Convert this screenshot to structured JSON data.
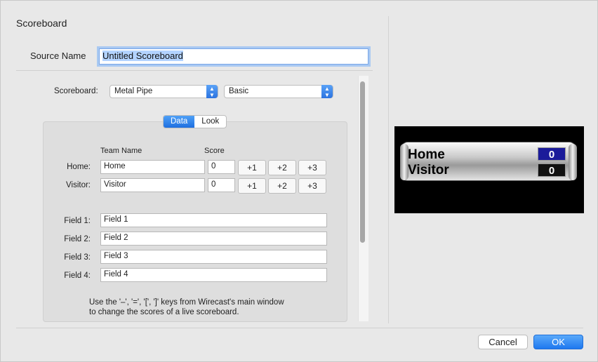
{
  "dialog": {
    "title": "Scoreboard"
  },
  "source": {
    "label": "Source Name",
    "value": "Untitled Scoreboard"
  },
  "scoreboard": {
    "label": "Scoreboard:",
    "style_value": "Metal Pipe",
    "mode_value": "Basic"
  },
  "tabs": [
    {
      "label": "Data",
      "active": true
    },
    {
      "label": "Look",
      "active": false
    }
  ],
  "columns": {
    "team_name": "Team Name",
    "score": "Score"
  },
  "teams": [
    {
      "label": "Home:",
      "name": "Home",
      "score": "0"
    },
    {
      "label": "Visitor:",
      "name": "Visitor",
      "score": "0"
    }
  ],
  "increments": [
    "+1",
    "+2",
    "+3"
  ],
  "fields": [
    {
      "label": "Field 1:",
      "value": "Field 1"
    },
    {
      "label": "Field 2:",
      "value": "Field 2"
    },
    {
      "label": "Field 3:",
      "value": "Field 3"
    },
    {
      "label": "Field 4:",
      "value": "Field 4"
    }
  ],
  "help": {
    "line1": "Use the '–', '=', '[', ']' keys from Wirecast's main window",
    "line2": "to change the scores of a live scoreboard."
  },
  "preview": {
    "home": "Home",
    "visitor": "Visitor",
    "home_score": "0",
    "visitor_score": "0",
    "home_score_color": "#1b1b9a",
    "visitor_score_color": "#111111"
  },
  "buttons": {
    "cancel": "Cancel",
    "ok": "OK"
  },
  "colors": {
    "accent": "#1e78ef"
  }
}
